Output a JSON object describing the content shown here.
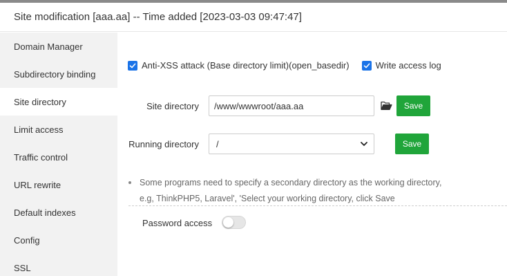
{
  "header": {
    "title": "Site modification [aaa.aa] -- Time added [2023-03-03 09:47:47]"
  },
  "sidebar": {
    "items": [
      {
        "label": "Domain Manager",
        "active": false
      },
      {
        "label": "Subdirectory binding",
        "active": false
      },
      {
        "label": "Site directory",
        "active": true
      },
      {
        "label": "Limit access",
        "active": false
      },
      {
        "label": "Traffic control",
        "active": false
      },
      {
        "label": "URL rewrite",
        "active": false
      },
      {
        "label": "Default indexes",
        "active": false
      },
      {
        "label": "Config",
        "active": false
      },
      {
        "label": "SSL",
        "active": false
      }
    ]
  },
  "main": {
    "options": {
      "anti_xss_label": "Anti-XSS attack (Base directory limit)(open_basedir)",
      "anti_xss_checked": true,
      "access_log_label": "Write access log",
      "access_log_checked": true
    },
    "site_directory": {
      "label": "Site directory",
      "value": "/www/wwwroot/aaa.aa",
      "save_label": "Save"
    },
    "running_directory": {
      "label": "Running directory",
      "selected": "/",
      "save_label": "Save"
    },
    "tip": {
      "line1": "Some programs need to specify a secondary directory as the working directory,",
      "line2": "e.g, ThinkPHP5, Laravel', 'Select your working directory, click Save"
    },
    "password_access": {
      "label": "Password access",
      "enabled": false
    }
  },
  "colors": {
    "accent_green": "#20a53a",
    "checkbox_blue": "#1a73e8",
    "sidebar_bg": "#f2f2f2"
  },
  "icons": [
    "checkmark-icon",
    "folder-open-icon",
    "chevron-down-icon"
  ]
}
